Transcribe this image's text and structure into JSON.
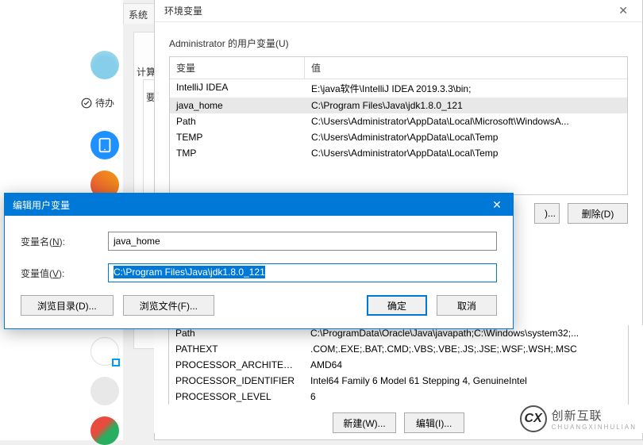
{
  "bg": {
    "tab_label": "系统",
    "pending": "待办",
    "calc": "计算",
    "ytag": "要"
  },
  "env": {
    "title": "环境变量",
    "user_section": "Administrator 的用户变量(U)",
    "col_name": "变量",
    "col_value": "值",
    "user_vars": [
      {
        "name": "IntelliJ IDEA",
        "value": "E:\\java软件\\IntelliJ IDEA 2019.3.3\\bin;"
      },
      {
        "name": "java_home",
        "value": "C:\\Program Files\\Java\\jdk1.8.0_121",
        "selected": true
      },
      {
        "name": "Path",
        "value": "C:\\Users\\Administrator\\AppData\\Local\\Microsoft\\WindowsA..."
      },
      {
        "name": "TEMP",
        "value": "C:\\Users\\Administrator\\AppData\\Local\\Temp"
      },
      {
        "name": "TMP",
        "value": "C:\\Users\\Administrator\\AppData\\Local\\Temp"
      }
    ],
    "btn_partial": ")...",
    "btn_delete": "删除(D)",
    "sys_vars": [
      {
        "name": "Path",
        "value": "C:\\ProgramData\\Oracle\\Java\\javapath;C:\\Windows\\system32;..."
      },
      {
        "name": "PATHEXT",
        "value": ".COM;.EXE;.BAT;.CMD;.VBS;.VBE;.JS;.JSE;.WSF;.WSH;.MSC"
      },
      {
        "name": "PROCESSOR_ARCHITECT...",
        "value": "AMD64"
      },
      {
        "name": "PROCESSOR_IDENTIFIER",
        "value": "Intel64 Family 6 Model 61 Stepping 4, GenuineIntel"
      },
      {
        "name": "PROCESSOR_LEVEL",
        "value": "6"
      }
    ],
    "btn_new": "新建(W)...",
    "btn_edit": "编辑(I)..."
  },
  "dialog": {
    "title": "编辑用户变量",
    "name_label": "变量名(N):",
    "name_value": "java_home",
    "value_label": "变量值(V):",
    "value_value": "C:\\Program Files\\Java\\jdk1.8.0_121",
    "browse_dir": "浏览目录(D)...",
    "browse_file": "浏览文件(F)...",
    "ok": "确定",
    "cancel": "取消"
  },
  "logo": {
    "text": "创新互联",
    "sub": "CHUANGXINHULIAN",
    "icon": "CX"
  }
}
